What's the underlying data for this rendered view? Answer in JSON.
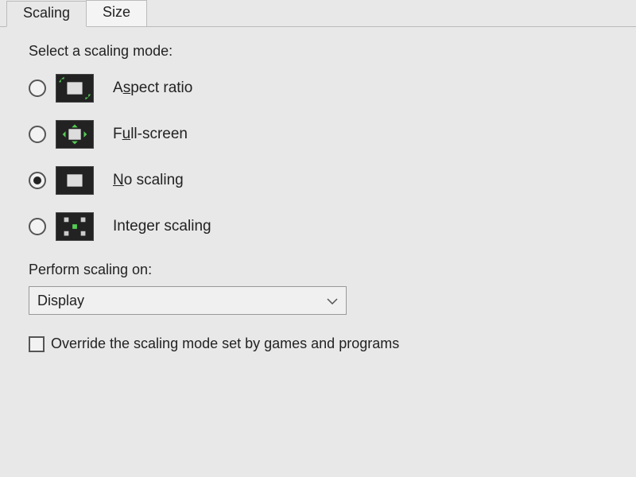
{
  "tabs": {
    "scaling": "Scaling",
    "size": "Size"
  },
  "panel": {
    "select_mode_label": "Select a scaling mode:",
    "options": {
      "aspect_ratio": "Aspect ratio",
      "full_screen": "Full-screen",
      "no_scaling": "No scaling",
      "integer_scaling": "Integer scaling"
    },
    "selected_option": "no_scaling",
    "perform_on_label": "Perform scaling on:",
    "perform_on_value": "Display",
    "override_label": "Override the scaling mode set by games and programs",
    "override_checked": false
  }
}
